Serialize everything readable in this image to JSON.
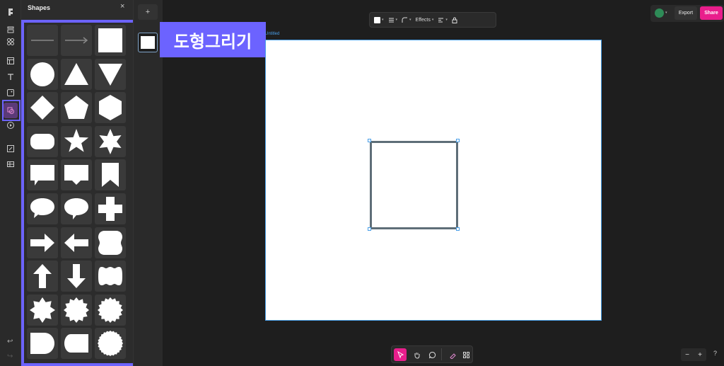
{
  "panel": {
    "title": "Shapes",
    "close": "×"
  },
  "pages": {
    "add": "+"
  },
  "annotation": {
    "label": "도형그리기"
  },
  "toolbar": {
    "effects": "Effects"
  },
  "header": {
    "export": "Export",
    "share": "Share"
  },
  "canvas": {
    "frame_label": "Untitled"
  },
  "zoom": {
    "minus": "−",
    "plus": "+",
    "help": "?"
  },
  "history": {
    "undo": "↩",
    "redo": "↪"
  },
  "shapes": [
    "line",
    "arrow-line",
    "square",
    "circle",
    "triangle",
    "triangle-down",
    "diamond",
    "pentagon",
    "hexagon",
    "rounded-rect",
    "star",
    "six-point-star",
    "callout-rect",
    "callout-rect-2",
    "bookmark",
    "speech-bubble",
    "speech-bubble-2",
    "cross",
    "arrow-right",
    "arrow-left",
    "rounded-blob",
    "arrow-up",
    "arrow-down",
    "cloud-rect",
    "burst-8",
    "burst-12",
    "burst-16",
    "d-shape",
    "pill-half",
    "seal"
  ],
  "colors": {
    "accent": "#e91e8c",
    "highlight": "#6c63ff",
    "selection": "#4a9fe8"
  }
}
